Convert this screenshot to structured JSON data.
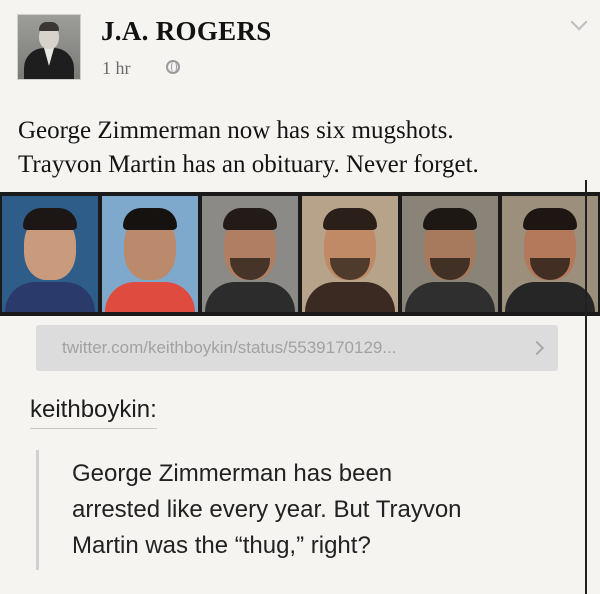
{
  "post": {
    "author": "J.A. ROGERS",
    "timestamp": "1 hr",
    "privacy_icon": "globe-icon",
    "menu_icon": "chevron-down-icon",
    "text_lines": [
      "George Zimmerman now has six mugshots.",
      "Trayvon Martin has an obituary. Never forget."
    ],
    "mugshots": [
      {
        "bg": "#2f5d8a",
        "skin": "#c99b7c",
        "hair": "#1c1714",
        "shirt": "#2a3a6a",
        "beard": false
      },
      {
        "bg": "#7ea9cc",
        "skin": "#bb8a6c",
        "hair": "#161210",
        "shirt": "#e04b3f",
        "beard": false
      },
      {
        "bg": "#8b8a86",
        "skin": "#b07f62",
        "hair": "#231b17",
        "shirt": "#2c2c2c",
        "beard": true
      },
      {
        "bg": "#b7a38a",
        "skin": "#c08a66",
        "hair": "#2a2019",
        "shirt": "#3a2a22",
        "beard": true
      },
      {
        "bg": "#8a8378",
        "skin": "#a87a5d",
        "hair": "#1e1814",
        "shirt": "#2f2f2f",
        "beard": true
      },
      {
        "bg": "#9c8f7c",
        "skin": "#b3795a",
        "hair": "#1d1612",
        "shirt": "#262626",
        "beard": true
      }
    ]
  },
  "link": {
    "url": "twitter.com/keithboykin/status/5539170129...",
    "arrow_icon": "chevron-right-icon"
  },
  "quote": {
    "username": "keithboykin:",
    "lines": [
      "George Zimmerman has been",
      "arrested like every year. But Trayvon",
      "Martin was the “thug,” right?"
    ]
  }
}
